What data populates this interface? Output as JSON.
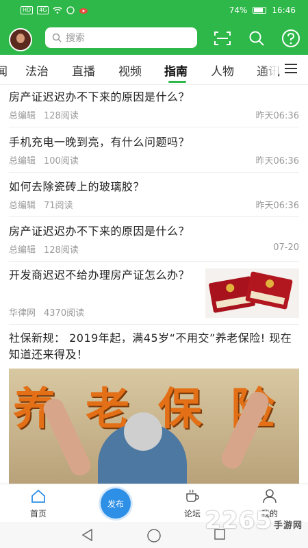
{
  "status": {
    "left_chips": [
      "HD",
      "4G"
    ],
    "battery": "74%",
    "time": "16:46"
  },
  "header": {
    "search_placeholder": "搜索"
  },
  "tabs": [
    "闻",
    "法治",
    "直播",
    "视频",
    "指南",
    "人物",
    "通讯"
  ],
  "active_tab": "指南",
  "feed": [
    {
      "title": "房产证迟迟办不下来的原因是什么？",
      "author": "总编辑",
      "reads": "128阅读",
      "time": "昨天06:36"
    },
    {
      "title": "手机充电一晚到亮，有什么问题吗？",
      "author": "总编辑",
      "reads": "100阅读",
      "time": "昨天06:36"
    },
    {
      "title": "如何去除瓷砖上的玻璃胶？",
      "author": "总编辑",
      "reads": "71阅读",
      "time": "昨天06:36"
    },
    {
      "title": "房产证迟迟办不下来的原因是什么？",
      "author": "总编辑",
      "reads": "128阅读",
      "time": "07-20"
    },
    {
      "title": "开发商迟迟不给办理房产证怎么办？",
      "author": "华律网",
      "reads": "4370阅读",
      "time": ""
    },
    {
      "title": "社保新规： 2019年起，满45岁“不用交”养老保险! 现在知道还来得及！"
    }
  ],
  "big_image_text": [
    "养",
    "老",
    "保",
    "险"
  ],
  "bottom_nav": {
    "home": "首页",
    "publish": "发布",
    "forum": "论坛",
    "mine": "我的"
  },
  "watermark": {
    "main": "2265",
    "sub": "手游网"
  },
  "colors": {
    "brand_green": "#2fb84a",
    "publish_blue": "#2d8fe6"
  }
}
